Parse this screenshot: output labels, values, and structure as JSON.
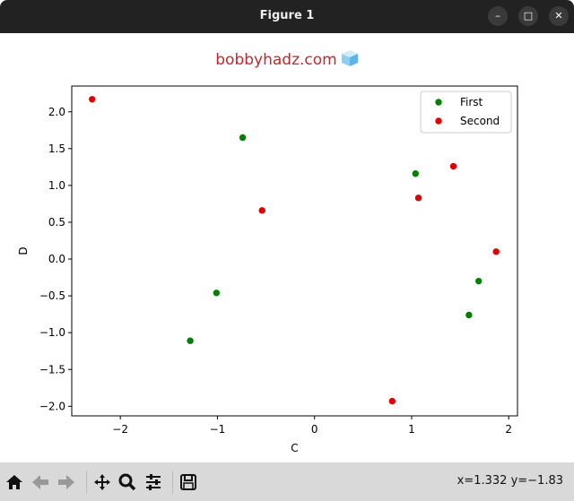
{
  "window": {
    "title": "Figure 1",
    "buttons": [
      "minimize",
      "maximize",
      "close"
    ]
  },
  "figure_title": "bobbyhadz.com",
  "figure_title_icon": "ice-cube-icon",
  "toolbar": {
    "icons": [
      "home-icon",
      "back-arrow-icon",
      "forward-arrow-icon",
      "pan-icon",
      "zoom-icon",
      "configure-subplots-icon",
      "save-icon"
    ],
    "coords": "x=1.332 y=−1.83"
  },
  "chart_data": {
    "type": "scatter",
    "xlabel": "C",
    "ylabel": "D",
    "xlim": [
      -2.5,
      2.09
    ],
    "ylim": [
      -2.13,
      2.35
    ],
    "xticks": [
      -2,
      -1,
      0,
      1,
      2
    ],
    "xtick_labels": [
      "−2",
      "−1",
      "0",
      "1",
      "2"
    ],
    "yticks": [
      2.0,
      1.5,
      1.0,
      0.5,
      0.0,
      -0.5,
      -1.0,
      -1.5,
      -2.0
    ],
    "ytick_labels": [
      "2.0",
      "1.5",
      "1.0",
      "0.5",
      "0.0",
      "−0.5",
      "−1.0",
      "−1.5",
      "−2.0"
    ],
    "grid": false,
    "legend": "top-right",
    "series": [
      {
        "name": "First",
        "color": "#008000",
        "x": [
          -0.74,
          1.04,
          -1.01,
          -1.28,
          1.69,
          1.59
        ],
        "y": [
          1.65,
          1.16,
          -0.46,
          -1.11,
          -0.3,
          -0.76
        ]
      },
      {
        "name": "Second",
        "color": "#e00000",
        "x": [
          -2.29,
          -0.54,
          1.43,
          1.07,
          1.87,
          0.8
        ],
        "y": [
          2.17,
          0.66,
          1.26,
          0.83,
          0.1,
          -1.93
        ]
      }
    ]
  }
}
